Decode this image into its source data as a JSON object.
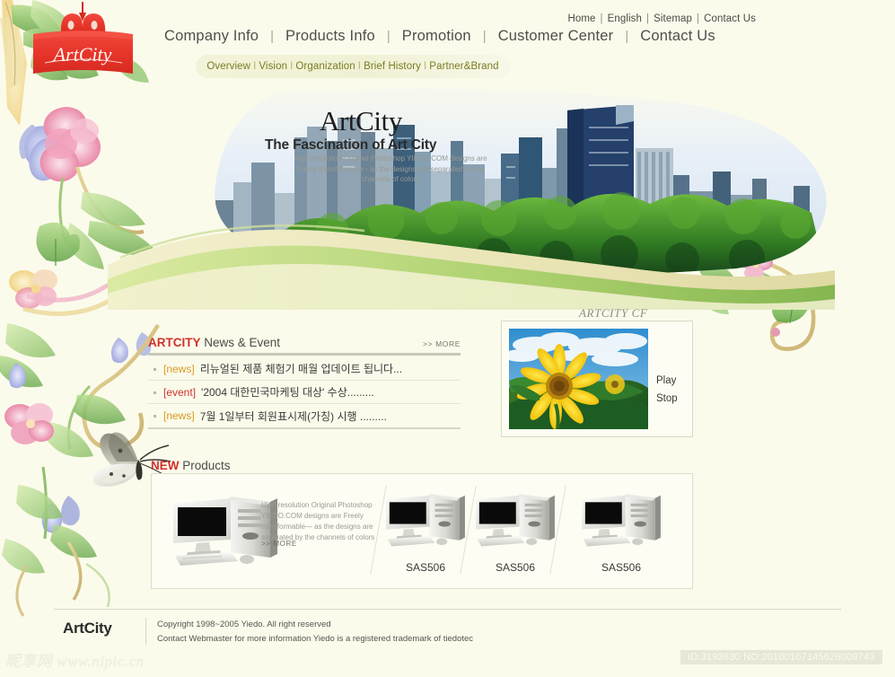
{
  "site": {
    "logo_text": "ArtCity",
    "background_color": "#fbfbec",
    "accent_red": "#d2322a",
    "accent_gold": "#d99a22"
  },
  "header": {
    "toplinks": [
      {
        "label": "Home"
      },
      {
        "label": "English"
      },
      {
        "label": "Sitemap"
      },
      {
        "label": "Contact Us"
      }
    ],
    "separator": "|",
    "mainnav": [
      {
        "label": "Company Info"
      },
      {
        "label": "Products Info"
      },
      {
        "label": "Promotion"
      },
      {
        "label": "Customer Center"
      },
      {
        "label": "Contact Us"
      }
    ],
    "subnav": [
      {
        "label": "Overview"
      },
      {
        "label": "Vision"
      },
      {
        "label": "Organization"
      },
      {
        "label": "Brief History"
      },
      {
        "label": "Partner&Brand"
      }
    ],
    "subnav_separator": "I"
  },
  "hero": {
    "title": "ArtCity",
    "subtitle": "The Fascination of Art City",
    "description": "High resolution Original Photoshop YIEDO.COM  designs are Freely transformable-- as the designs are separated  by  the channels of colors"
  },
  "news": {
    "brand": "ARTCITY",
    "heading": " News & Event",
    "more_label": ">> MORE",
    "items": [
      {
        "tag": "[news]",
        "tag_type": "news",
        "text": "리뉴얼된 제품 체험기 매월 업데이트 됩니다..."
      },
      {
        "tag": "[event]",
        "tag_type": "event",
        "text": "'2004 대한민국마케팅 대상' 수상........."
      },
      {
        "tag": "[news]",
        "tag_type": "news",
        "text": "7월 1일부터 회원표시제(가칭) 시행 ........."
      }
    ]
  },
  "cf": {
    "label": "ARTCITY CF",
    "play_label": "Play",
    "stop_label": "Stop",
    "photo_alt": "sunflower-photo"
  },
  "products": {
    "new_badge": "NEW",
    "heading": " Products",
    "featured": {
      "description": "High resolution Original Photoshop YIEDO.COM  designs are Freely transformable—  as the designs are separated  by  the channels of colors",
      "more_label": ">> MORE"
    },
    "items": [
      {
        "name": "SAS506"
      },
      {
        "name": "SAS506"
      },
      {
        "name": "SAS506"
      }
    ]
  },
  "footer": {
    "logo": "ArtCity",
    "copyright": "Copyright 1998~2005 Yiedo. All right reserved",
    "contact": "Contact Webmaster for more information  Yiedo is a registered trademark of tiedotec"
  },
  "watermarks": {
    "left": "昵享网 www.nipic.cn",
    "right": "ID:3193830 NO:20100107145626009743"
  }
}
